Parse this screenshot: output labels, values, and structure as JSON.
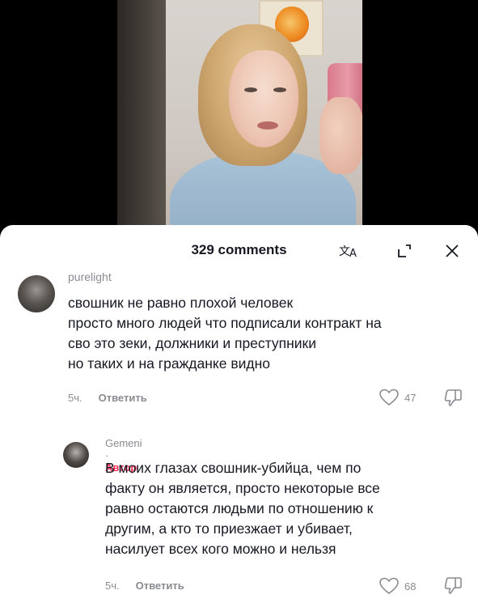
{
  "header": {
    "comment_count": "329 comments",
    "translate_icon": "translate-icon",
    "expand_icon": "expand-icon",
    "close_icon": "close-icon"
  },
  "comments": [
    {
      "username": "purelight",
      "text_lines": [
        "свошник не равно плохой человек",
        "просто много людей что подписали контракт на",
        "сво это зеки, должники и преступники",
        "но таких и на гражданке видно"
      ],
      "time": "5ч.",
      "reply_label": "Ответить",
      "likes": "47"
    },
    {
      "username": "Gemeni",
      "separator": " · ",
      "author_badge": "Автор",
      "text_lines": [
        "В моих глазах свошник-убийца, чем по",
        "факту он является, просто некоторые все",
        "равно остаются людьми по отношению к",
        "другим, а кто то приезжает и убивает,",
        "насилует всех кого можно и нельзя"
      ],
      "time": "5ч.",
      "reply_label": "Ответить",
      "likes": "68"
    }
  ]
}
